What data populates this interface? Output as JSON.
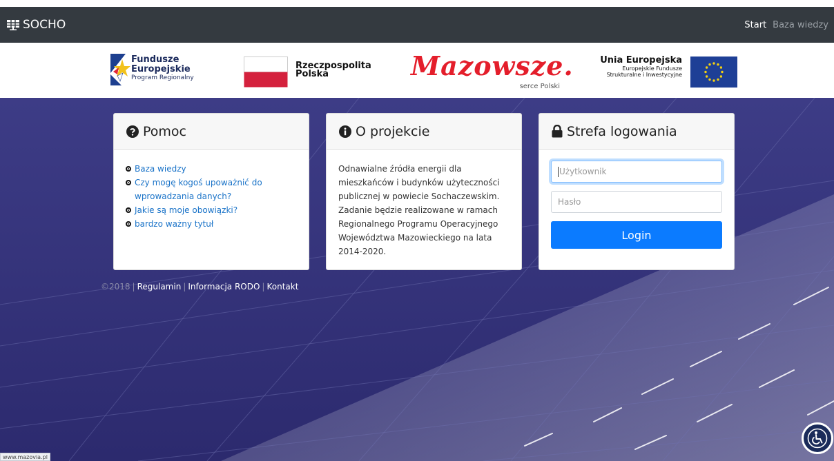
{
  "navbar": {
    "brand": "SOCHO",
    "links": [
      {
        "label": "Start"
      },
      {
        "label": "Baza wiedzy"
      }
    ]
  },
  "logos": {
    "fundusze": {
      "line1": "Fundusze",
      "line2": "Europejskie",
      "line3": "Program Regionalny"
    },
    "rzeczpospolita": {
      "line1": "Rzeczpospolita",
      "line2": "Polska"
    },
    "mazowsze": {
      "word": "Mazowsze.",
      "tagline": "serce Polski"
    },
    "unia": {
      "line1": "Unia Europejska",
      "line2": "Europejskie Fundusze",
      "line3": "Strukturalne i Inwestycyjne"
    }
  },
  "help": {
    "title": "Pomoc",
    "links": [
      {
        "label": "Baza wiedzy"
      },
      {
        "label": "Czy mogę kogoś upoważnić do wprowadzania danych?"
      },
      {
        "label": "Jakie są moje obowiązki?"
      },
      {
        "label": "bardzo ważny tytuł"
      }
    ]
  },
  "project": {
    "title": "O projekcie",
    "body": "Odnawialne źródła energii dla mieszkańców i budynków użyteczności publicznej w powiecie Sochaczewskim. Zadanie będzie realizowane w ramach Regionalnego Programu Operacyjnego Województwa Mazowieckiego na lata 2014-2020."
  },
  "login": {
    "title": "Strefa logowania",
    "username_placeholder": "Użytkownik",
    "password_placeholder": "Hasło",
    "submit_label": "Login"
  },
  "footer": {
    "copyright": "©2018",
    "sep": "|",
    "links": [
      {
        "label": "Regulamin"
      },
      {
        "label": "Informacja RODO"
      },
      {
        "label": "Kontakt"
      }
    ]
  },
  "status_bar": {
    "url": "www.mazovia.pl"
  },
  "colors": {
    "navbar": "#343a40",
    "hero": "#3b3a82",
    "link": "#1a73c8",
    "primary_button": "#0b7bff",
    "mazowsze_red": "#e41e2b"
  },
  "icons": {
    "brand": "solar-panel-icon",
    "help": "question-circle-icon",
    "project": "info-circle-icon",
    "login": "lock-icon",
    "bullet": "dot-circle-icon",
    "accessibility": "wheelchair-accessibility-icon"
  }
}
